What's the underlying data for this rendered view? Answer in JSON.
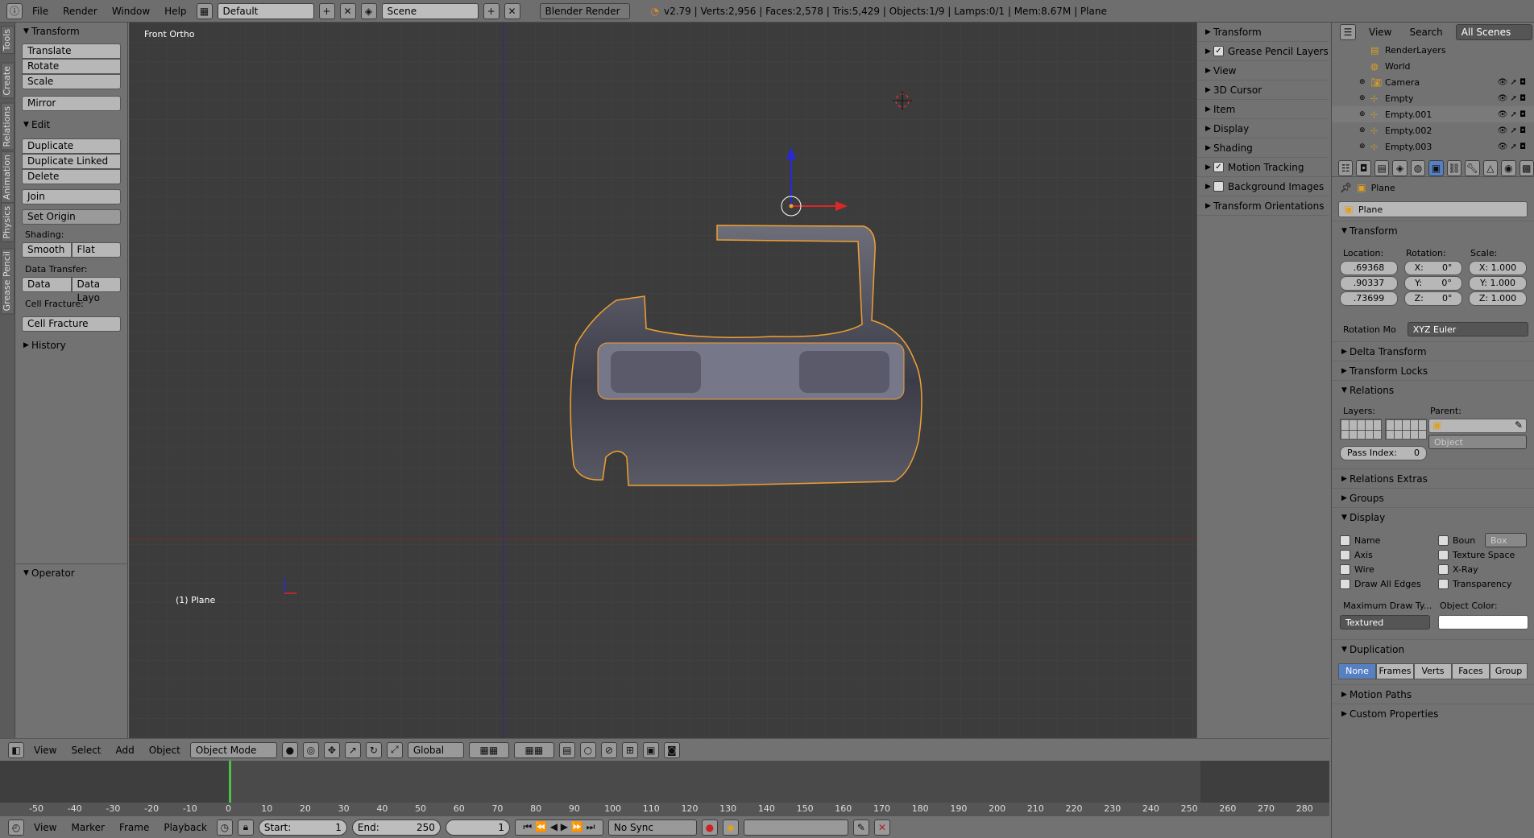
{
  "topbar": {
    "menus": [
      "File",
      "Render",
      "Window",
      "Help"
    ],
    "layout": "Default",
    "scene": "Scene",
    "engine": "Blender Render",
    "stats": "v2.79 | Verts:2,956 | Faces:2,578 | Tris:5,429 | Objects:1/9 | Lamps:0/1 | Mem:8.67M | Plane"
  },
  "tabs": [
    "Tools",
    "Create",
    "Relations",
    "Animation",
    "Physics",
    "Grease Pencil"
  ],
  "toolshelf": {
    "transform_title": "Transform",
    "translate": "Translate",
    "rotate": "Rotate",
    "scale": "Scale",
    "mirror": "Mirror",
    "edit_title": "Edit",
    "duplicate": "Duplicate",
    "duplicate_linked": "Duplicate Linked",
    "delete": "Delete",
    "join": "Join",
    "set_origin": "Set Origin",
    "shading_label": "Shading:",
    "smooth": "Smooth",
    "flat": "Flat",
    "data_transfer_label": "Data Transfer:",
    "data": "Data",
    "data_layo": "Data Layo",
    "cell_fracture_label": "Cell Fracture:",
    "cell_fracture": "Cell Fracture",
    "history": "History",
    "operator": "Operator"
  },
  "viewport": {
    "view_name": "Front Ortho",
    "object_label": "(1) Plane"
  },
  "npanel": {
    "items": [
      {
        "label": "Transform",
        "check": false
      },
      {
        "label": "Grease Pencil Layers",
        "check": true
      },
      {
        "label": "View",
        "check": false
      },
      {
        "label": "3D Cursor",
        "check": false
      },
      {
        "label": "Item",
        "check": false
      },
      {
        "label": "Display",
        "check": false
      },
      {
        "label": "Shading",
        "check": false
      },
      {
        "label": "Motion Tracking",
        "check": true
      },
      {
        "label": "Background Images",
        "check": true
      },
      {
        "label": "Transform Orientations",
        "check": false
      }
    ]
  },
  "vheader": {
    "menus": [
      "View",
      "Select",
      "Add",
      "Object"
    ],
    "mode": "Object Mode",
    "orientation": "Global"
  },
  "timeline": {
    "ticks": [
      "-50",
      "-40",
      "-30",
      "-20",
      "-10",
      "0",
      "10",
      "20",
      "30",
      "40",
      "50",
      "60",
      "70",
      "80",
      "90",
      "100",
      "110",
      "120",
      "130",
      "140",
      "150",
      "160",
      "170",
      "180",
      "190",
      "200",
      "210",
      "220",
      "230",
      "240",
      "250",
      "260",
      "270",
      "280"
    ],
    "menus": [
      "View",
      "Marker",
      "Frame",
      "Playback"
    ],
    "start_label": "Start:",
    "start": "1",
    "end_label": "End:",
    "end": "250",
    "current": "1",
    "sync": "No Sync"
  },
  "outliner": {
    "menus": [
      "View",
      "Search"
    ],
    "filter": "All Scenes",
    "rows": [
      "RenderLayers",
      "World",
      "Camera",
      "Empty",
      "Empty.001",
      "Empty.002",
      "Empty.003"
    ]
  },
  "props": {
    "breadcrumb": "Plane",
    "object_name": "Plane",
    "transform_title": "Transform",
    "location_label": "Location:",
    "rotation_label": "Rotation:",
    "scale_label": "Scale:",
    "location": [
      ".69368",
      ".90337",
      ".73699"
    ],
    "rotation": [
      "X:",
      "Y:",
      "Z:"
    ],
    "rotation_vals": [
      "0°",
      "0°",
      "0°"
    ],
    "scale": [
      "X: 1.000",
      "Y: 1.000",
      "Z: 1.000"
    ],
    "rotation_mode_label": "Rotation Mo",
    "rotation_mode": "XYZ Euler",
    "delta_transform": "Delta Transform",
    "transform_locks": "Transform Locks",
    "relations": "Relations",
    "layers_label": "Layers:",
    "parent_label": "Parent:",
    "parent_type": "Object",
    "pass_index_label": "Pass Index:",
    "pass_index": "0",
    "relations_extras": "Relations Extras",
    "groups": "Groups",
    "display": "Display",
    "display_left": [
      "Name",
      "Axis",
      "Wire",
      "Draw All Edges"
    ],
    "display_right": [
      "Boun",
      "Texture Space",
      "X-Ray",
      "Transparency"
    ],
    "bounds_type": "Box",
    "max_draw_label": "Maximum Draw Ty...",
    "object_color_label": "Object Color:",
    "draw_type": "Textured",
    "duplication": "Duplication",
    "dup_options": [
      "None",
      "Frames",
      "Verts",
      "Faces",
      "Group"
    ],
    "motion_paths": "Motion Paths",
    "custom_properties": "Custom Properties"
  },
  "colors": {
    "selection_outline": "#f0a030",
    "x_axis": "#d02020",
    "z_axis": "#2020d0",
    "active_blue": "#5680c2"
  }
}
